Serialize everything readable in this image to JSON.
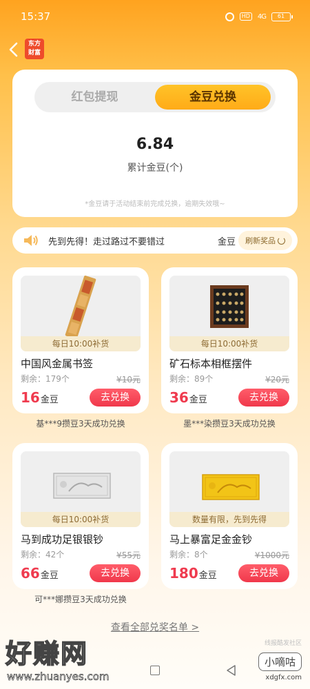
{
  "status_bar": {
    "time": "15:37",
    "hd": "HD",
    "signal": "4G",
    "battery": "61"
  },
  "header": {
    "back_icon": "chevron-left-icon",
    "logo_text_line1": "东方",
    "logo_text_line2": "财富"
  },
  "exchange_card": {
    "tabs": [
      {
        "label": "红包提现",
        "active": false
      },
      {
        "label": "金豆兑换",
        "active": true
      }
    ],
    "total_value": "6.84",
    "total_label": "累计金豆(个)",
    "tip": "*金豆请于活动结束前完成兑换，逾期失效哦~"
  },
  "notice": {
    "icon": "speaker-icon",
    "text": "先到先得！走过路过不要错过",
    "scroll_text": "金豆",
    "refresh_label": "刷新奖品",
    "refresh_icon": "refresh-icon"
  },
  "prizes": [
    {
      "name": "中国风金属书签",
      "restock": "每日10:00补货",
      "stock": "剩余：179个",
      "original_price": "¥10元",
      "price": "16",
      "unit": "金豆",
      "button": "去兑换",
      "note": "基***9攒豆3天成功兑换"
    },
    {
      "name": "矿石标本相框摆件",
      "restock": "每日10:00补货",
      "stock": "剩余：89个",
      "original_price": "¥20元",
      "price": "36",
      "unit": "金豆",
      "button": "去兑换",
      "note": "墨***染攒豆3天成功兑换"
    },
    {
      "name": "马到成功足银银钞",
      "restock": "每日10:00补货",
      "stock": "剩余：42个",
      "original_price": "¥55元",
      "price": "66",
      "unit": "金豆",
      "button": "去兑换",
      "note": "可***娜攒豆3天成功兑换"
    },
    {
      "name": "马上暴富足金金钞",
      "restock": "数量有限，先到先得",
      "stock": "剩余：8个",
      "original_price": "¥1000元",
      "price": "180",
      "unit": "金豆",
      "button": "去兑换",
      "note": ""
    }
  ],
  "view_all": "查看全部兑奖名单 >",
  "watermarks": {
    "left_title": "好赚网",
    "left_url": "www.zhuanyes.com",
    "right_small": "线报酷发社区",
    "right_badge": "小嘀咕",
    "right_domain": "xdgfx.com"
  },
  "colors": {
    "accent": "#ffab18",
    "price": "#ef3b4f",
    "button": "#f0384b"
  }
}
